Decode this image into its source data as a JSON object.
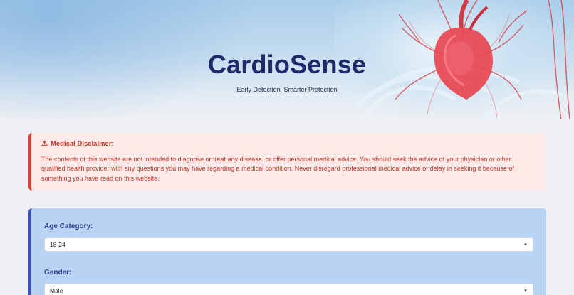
{
  "header": {
    "title": "CardioSense",
    "subtitle": "Early Detection, Smarter Protection",
    "hero_image": "heart-illustration"
  },
  "disclaimer": {
    "icon": "warning-icon",
    "title": "Medical Disclaimer:",
    "text": "The contents of this website are not intended to diagnose or treat any disease, or offer personal medical advice. You should seek the advice of your physician or other qualified health provider with any questions you may have regarding a medical condition. Never disregard professional medical advice or delay in seeking it because of something you have read on this website.",
    "color": "#c0392b",
    "background": "#fde9e7"
  },
  "form": {
    "accent": "#3f51b5",
    "background": "#b8d3f3",
    "fields": [
      {
        "label": "Age Category:",
        "value": "18-24"
      },
      {
        "label": "Gender:",
        "value": "Male"
      }
    ]
  }
}
